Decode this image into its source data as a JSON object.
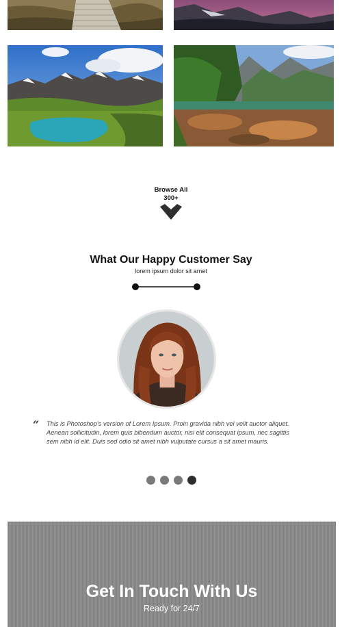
{
  "gallery": {
    "tiles": [
      {
        "subject": "wooden boardwalk through dry grass"
      },
      {
        "subject": "mountain ridge at pink dusk"
      },
      {
        "subject": "alpine peaks above turquoise lake"
      },
      {
        "subject": "forest lake with green mountains"
      }
    ]
  },
  "browse": {
    "line1": "Browse All",
    "line2": "300+",
    "icon": "chevron-down-icon"
  },
  "testimonials": {
    "title": "What Our Happy Customer Say",
    "subtitle": "lorem ipsum dolor sit amet",
    "quote_mark": "“",
    "quote": "This is Photoshop's version of Lorem Ipsum. Proin gravida nibh vel velit auctor aliquet. Aenean sollicitudin, lorem quis bibendum auctor, nisi elit consequat ipsum, nec sagittis sem nibh id elit. Duis sed odio sit amet nibh vulputate cursus a sit amet mauris.",
    "slides_total": 4,
    "active_slide": 4
  },
  "contact": {
    "title": "Get In Touch With Us",
    "subtitle": "Ready for 24/7"
  },
  "colors": {
    "accent": "#111111",
    "dot_inactive": "#7a7a7a",
    "dot_active": "#2e2e2e",
    "contact_bg": "#8a8a8a"
  }
}
